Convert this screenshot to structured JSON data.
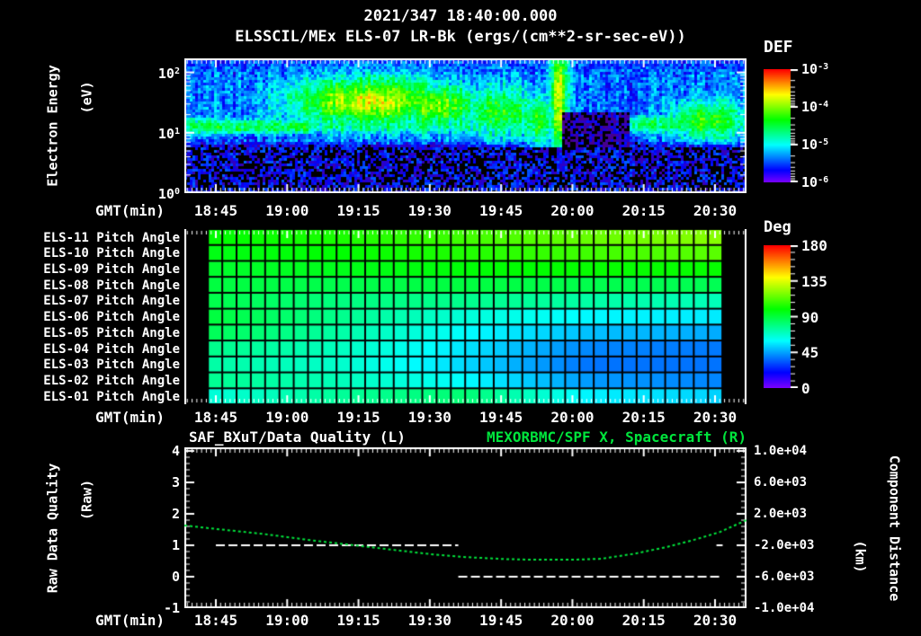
{
  "header": {
    "datetime": "2021/347 18:40:00.000",
    "title": "ELSSCIL/MEx ELS-07 LR-Bk  (ergs/(cm**2-sr-sec-eV))"
  },
  "colors": {
    "background": "#000000",
    "text": "#ffffff",
    "series_green": "#00e53c",
    "rainbow_low_to_high": [
      "#8000ff",
      "#0000ff",
      "#0080ff",
      "#00ffff",
      "#00ff80",
      "#00ff00",
      "#80ff00",
      "#ffff00",
      "#ff8000",
      "#ff0000"
    ]
  },
  "time_axis": {
    "label": "GMT(min)",
    "tick_labels": [
      "18:45",
      "19:00",
      "19:15",
      "19:30",
      "19:45",
      "20:00",
      "20:15",
      "20:30"
    ],
    "major_tick_interval_min": 15,
    "minor_tick_interval_min": 1
  },
  "spectrogram_panel": {
    "y_axis_label_line1": "Electron Energy",
    "y_axis_label_line2": "(eV)",
    "y_tick_labels": [
      {
        "base": "10",
        "exp": "2"
      },
      {
        "base": "10",
        "exp": "1"
      },
      {
        "base": "10",
        "exp": "0"
      }
    ],
    "colorbar": {
      "title": "DEF",
      "tick_labels": [
        {
          "base": "10",
          "exp": "-3"
        },
        {
          "base": "10",
          "exp": "-4"
        },
        {
          "base": "10",
          "exp": "-5"
        },
        {
          "base": "10",
          "exp": "-6"
        }
      ]
    }
  },
  "pitch_panel": {
    "colorbar": {
      "title": "Deg",
      "tick_labels": [
        "180",
        "135",
        "90",
        "45",
        "0"
      ]
    }
  },
  "bottom_panel": {
    "title_left": "SAF_BXuT/Data Quality (L)",
    "title_right": "MEXORBMC/SPF X, Spacecraft (R)",
    "y_axis_left_line1": "Raw Data Quality",
    "y_axis_left_line2": "(Raw)",
    "y_tick_labels_left": [
      "4",
      "3",
      "2",
      "1",
      "0",
      "-1"
    ],
    "y_axis_right_line1": "Component Distance",
    "y_axis_right_line2": "(km)",
    "y_tick_labels_right": [
      "1.0e+04",
      "6.0e+03",
      "2.0e+03",
      "-2.0e+03",
      "-6.0e+03",
      "-1.0e+04"
    ]
  },
  "chart_data": [
    {
      "type": "heatmap",
      "id": "electron-energy-spectrogram",
      "title": "ELSSCIL/MEx ELS-07 LR-Bk",
      "units": "ergs/(cm**2-sr-sec-eV)",
      "x_range_gmt": [
        "18:40",
        "20:35"
      ],
      "y_scale": "log",
      "y_range_ev": [
        1,
        175
      ],
      "z_log_range": [
        -6,
        -3
      ],
      "base_levels": {
        "low_energy_log_ev_below": 0.75,
        "low_level": -5.92,
        "mid_level": -5.38,
        "high_level": -5.55
      },
      "noise_amplitude": 0.28,
      "features": [
        {
          "kind": "band",
          "x0": 0.0,
          "x1": 1.0,
          "log_e_center": 1.12,
          "log_e_sigma": 0.22,
          "level": -4.75
        },
        {
          "kind": "band",
          "x0": 0.0,
          "x1": 0.24,
          "log_e_center": 1.1,
          "log_e_sigma": 0.17,
          "level": -4.5
        },
        {
          "kind": "blob",
          "cx": 0.33,
          "cy": 1.52,
          "sx": 0.1,
          "sy": 0.27,
          "level": -3.75
        },
        {
          "kind": "blob",
          "cx": 0.45,
          "cy": 1.45,
          "sx": 0.055,
          "sy": 0.25,
          "level": -4.05
        },
        {
          "kind": "blob",
          "cx": 0.56,
          "cy": 1.35,
          "sx": 0.05,
          "sy": 0.3,
          "level": -4.35
        },
        {
          "kind": "blob",
          "cx": 0.667,
          "cy": 1.6,
          "sx": 0.012,
          "sy": 0.7,
          "level": -3.85
        },
        {
          "kind": "blob",
          "cx": 0.63,
          "cy": 1.2,
          "sx": 0.02,
          "sy": 0.3,
          "level": -4.3
        },
        {
          "kind": "band",
          "x0": 0.78,
          "x1": 1.0,
          "log_e_center": 1.15,
          "log_e_sigma": 0.2,
          "level": -4.6
        },
        {
          "kind": "blob",
          "cx": 0.93,
          "cy": 1.2,
          "sx": 0.045,
          "sy": 0.22,
          "level": -4.25
        },
        {
          "kind": "dark",
          "x0": 0.67,
          "x1": 0.79,
          "log_e_max": 1.35,
          "level": -5.85
        }
      ]
    },
    {
      "type": "heatmap",
      "id": "pitch-angle-grid",
      "value_units": "deg",
      "z_range": [
        0,
        180
      ],
      "columns": 36,
      "x_data_frac": [
        0.042,
        0.957
      ],
      "rows": [
        {
          "label": "ELS-11 Pitch Angle",
          "values": [
            100,
            104,
            110,
            116,
            121
          ]
        },
        {
          "label": "ELS-10 Pitch Angle",
          "values": [
            97,
            100,
            105,
            110,
            114
          ]
        },
        {
          "label": "ELS-09 Pitch Angle",
          "values": [
            93,
            96,
            99,
            101,
            101
          ]
        },
        {
          "label": "ELS-08 Pitch Angle",
          "values": [
            90,
            88,
            90,
            88,
            87
          ]
        },
        {
          "label": "ELS-07 Pitch Angle",
          "values": [
            88,
            80,
            78,
            74,
            71
          ]
        },
        {
          "label": "ELS-06 Pitch Angle",
          "values": [
            90,
            78,
            66,
            59,
            57
          ]
        },
        {
          "label": "ELS-05 Pitch Angle",
          "values": [
            86,
            74,
            60,
            50,
            47
          ]
        },
        {
          "label": "ELS-04 Pitch Angle",
          "values": [
            78,
            70,
            56,
            41,
            39
          ]
        },
        {
          "label": "ELS-03 Pitch Angle",
          "values": [
            74,
            68,
            54,
            38,
            38
          ]
        },
        {
          "label": "ELS-02 Pitch Angle",
          "values": [
            77,
            71,
            60,
            44,
            41
          ]
        },
        {
          "label": "ELS-01 Pitch Angle",
          "values": [
            66,
            76,
            82,
            58,
            53
          ]
        }
      ]
    },
    {
      "type": "line",
      "id": "quality-and-spacecraft-x",
      "left_axis": {
        "label": "Raw Data Quality (Raw)",
        "range": [
          -1,
          4
        ]
      },
      "right_axis": {
        "label": "Component Distance (km)",
        "range": [
          -10000,
          10000
        ]
      },
      "series": [
        {
          "name": "MEXORBMC/SPF X, Spacecraft (R)",
          "axis": "right",
          "style": "dotted",
          "color": "#00e53c",
          "t_min_from_1840": [
            -1.6,
            5,
            15,
            25,
            33,
            42,
            50,
            58,
            66,
            72,
            80,
            86,
            93,
            100,
            106,
            111,
            116.6
          ],
          "raw_values": [
            1.63,
            1.52,
            1.36,
            1.16,
            1.02,
            0.86,
            0.72,
            0.62,
            0.56,
            0.54,
            0.54,
            0.57,
            0.73,
            0.95,
            1.19,
            1.42,
            1.8
          ],
          "km_values": [
            520,
            80,
            -560,
            -1360,
            -1920,
            -2560,
            -3120,
            -3520,
            -3760,
            -3840,
            -3840,
            -3720,
            -3080,
            -2200,
            -1240,
            -320,
            1200
          ]
        },
        {
          "name": "SAF_BXuT/Data Quality (L)",
          "axis": "left",
          "style": "dashed",
          "color": "#ffffff",
          "segments": [
            {
              "t0": 5,
              "t1": 56,
              "value": 1
            },
            {
              "t0": 56,
              "t1": 110.9,
              "value": 0
            },
            {
              "t0": 110.3,
              "t1": 111.6,
              "value": 1
            }
          ]
        }
      ]
    }
  ]
}
